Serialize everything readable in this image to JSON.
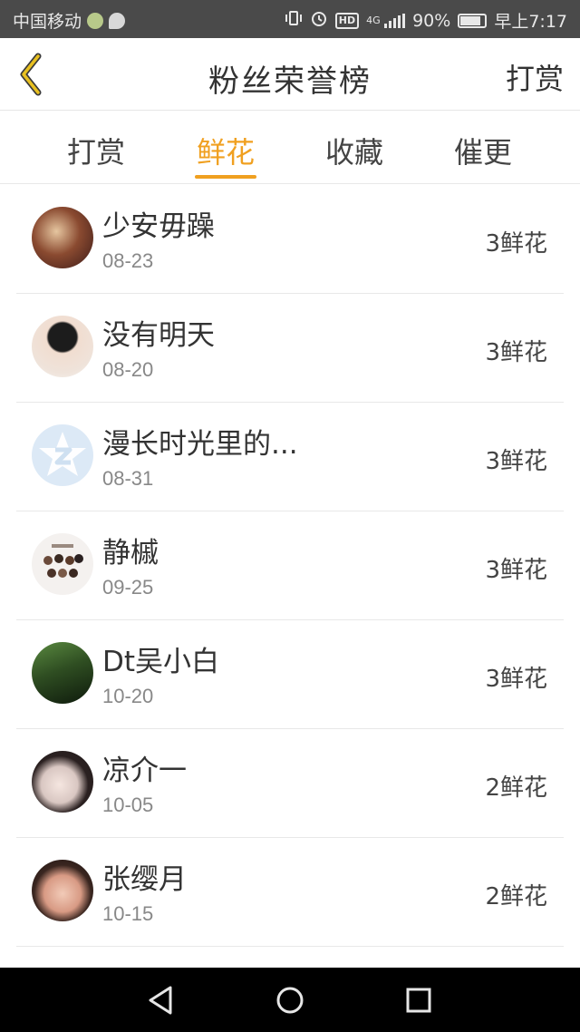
{
  "status_bar": {
    "carrier": "中国移动",
    "network": "4G",
    "battery": "90%",
    "time": "早上7:17",
    "hd_badge": "HD"
  },
  "header": {
    "back_icon": "chevron-left-icon",
    "title": "粉丝荣誉榜",
    "action_label": "打赏"
  },
  "tabs": [
    {
      "label": "打赏",
      "active": false
    },
    {
      "label": "鲜花",
      "active": true
    },
    {
      "label": "收藏",
      "active": false
    },
    {
      "label": "催更",
      "active": false
    }
  ],
  "colors": {
    "accent": "#f0a020",
    "status_bar_bg": "#4a4a4a",
    "nav_bar_bg": "#000000"
  },
  "list": [
    {
      "name": "少安毋躁",
      "date": "08-23",
      "amount": "3鲜花"
    },
    {
      "name": "没有明天",
      "date": "08-20",
      "amount": "3鲜花"
    },
    {
      "name": "漫长时光里的...",
      "date": "08-31",
      "amount": "3鲜花"
    },
    {
      "name": "静槭",
      "date": "09-25",
      "amount": "3鲜花"
    },
    {
      "name": "Dt吴小白",
      "date": "10-20",
      "amount": "3鲜花"
    },
    {
      "name": "凉介一",
      "date": "10-05",
      "amount": "2鲜花"
    },
    {
      "name": "张缨月",
      "date": "10-15",
      "amount": "2鲜花"
    }
  ]
}
